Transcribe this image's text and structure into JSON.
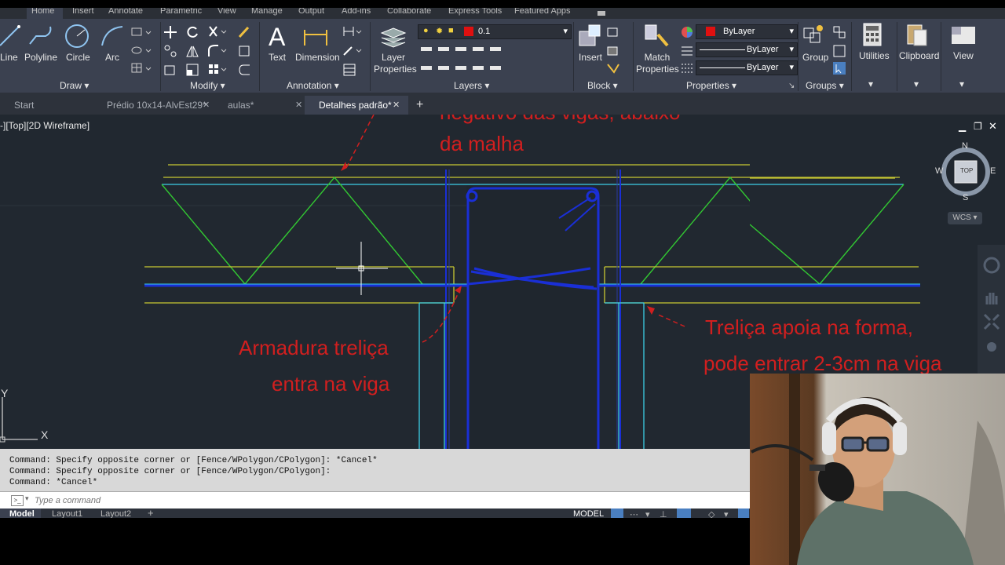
{
  "menu": {
    "items": [
      "Home",
      "Insert",
      "Annotate",
      "Parametric",
      "View",
      "Manage",
      "Output",
      "Add-ins",
      "Collaborate",
      "Express Tools",
      "Featured Apps"
    ]
  },
  "ribbon": {
    "draw": {
      "line": "Line",
      "polyline": "Polyline",
      "circle": "Circle",
      "arc": "Arc",
      "title": "Draw"
    },
    "modify": {
      "title": "Modify"
    },
    "annotation": {
      "text": "Text",
      "dimension": "Dimension",
      "title": "Annotation"
    },
    "layers": {
      "properties": "Layer Properties",
      "current_layer": "0.1",
      "title": "Layers"
    },
    "block": {
      "insert": "Insert",
      "title": "Block"
    },
    "properties": {
      "match": "Match Properties",
      "color": "ByLayer",
      "linetype": "ByLayer",
      "lineweight": "ByLayer",
      "title": "Properties"
    },
    "groups": {
      "group": "Group",
      "title": "Groups"
    },
    "utilities": "Utilities",
    "clipboard": "Clipboard",
    "view": "View"
  },
  "tabs": [
    {
      "label": "Start"
    },
    {
      "label": "Prédio 10x14-AlvEst29*"
    },
    {
      "label": "aulas*"
    },
    {
      "label": "Detalhes padrão*"
    }
  ],
  "viewport": {
    "label": "-][Top][2D Wireframe]",
    "viewcube": {
      "n": "N",
      "s": "S",
      "e": "E",
      "w": "W",
      "top": "TOP",
      "wcs": "WCS"
    },
    "ucs": {
      "y": "Y",
      "x": "X"
    }
  },
  "annotations": {
    "top_line1": "negativo das vigas, abaixo",
    "top_line2": "da malha",
    "left_line1": "Armadura treliça",
    "left_line2": "entra na viga",
    "right_line1": "Treliça apoia na forma,",
    "right_line2": "pode entrar 2-3cm na viga"
  },
  "command": {
    "history": [
      "Command: Specify opposite corner or [Fence/WPolygon/CPolygon]: *Cancel*",
      "Command: Specify opposite corner or [Fence/WPolygon/CPolygon]:",
      "Command: *Cancel*"
    ],
    "placeholder": "Type a command"
  },
  "status": {
    "model_tab": "Model",
    "layout1": "Layout1",
    "layout2": "Layout2",
    "model": "MODEL"
  },
  "colors": {
    "red_text": "#d11f1f",
    "green": "#32c832",
    "yellow": "#c8c832",
    "cyan": "#3ccfe6",
    "blue": "#1a2fd6",
    "canvas": "#212830"
  }
}
